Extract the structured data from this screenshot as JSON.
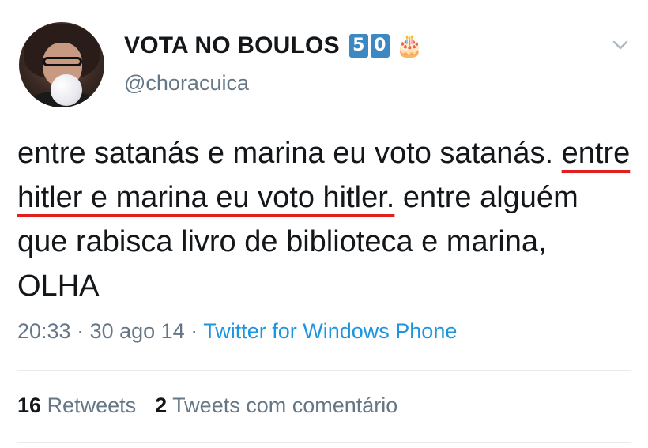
{
  "user": {
    "display_name": "VOTA NO BOULOS",
    "keycaps": [
      "5",
      "0"
    ],
    "cake_emoji": "🎂",
    "handle": "@choracuica"
  },
  "tweet": {
    "text_part1": "entre satanás e marina eu voto satanás. ",
    "highlight": "entre hitler e marina eu voto hitler.",
    "text_part2": " entre alguém que rabisca livro de biblioteca e marina, OLHA",
    "highlight_color": "#e0201f"
  },
  "meta": {
    "time": "20:33",
    "separator": " · ",
    "date": "30 ago 14",
    "source": "Twitter for Windows Phone"
  },
  "stats": {
    "retweets_count": "16",
    "retweets_label": "Retweets",
    "quotes_count": "2",
    "quotes_label": "Tweets com comentário"
  },
  "icons": {
    "menu": "chevron-down-icon",
    "emoji": "birthday-cake-icon"
  }
}
